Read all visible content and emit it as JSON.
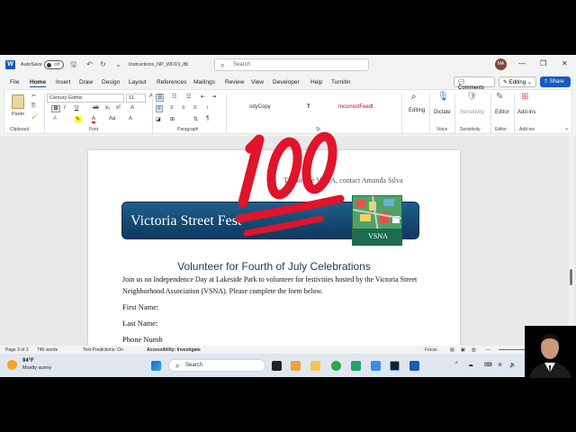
{
  "titlebar": {
    "autosave_label": "AutoSave",
    "autosave_state": "Off",
    "doc_title": "Instructions_NP_WD19_8b",
    "search_placeholder": "Search",
    "avatar_initials": "MA"
  },
  "menu": {
    "tabs": [
      "File",
      "Home",
      "Insert",
      "Draw",
      "Design",
      "Layout",
      "References",
      "Mailings",
      "Review",
      "View",
      "Developer",
      "Help",
      "Turnitin"
    ],
    "active_tab": "Home",
    "comments_label": "Comments",
    "editing_label": "Editing",
    "share_label": "Share"
  },
  "ribbon": {
    "paste_label": "Paste",
    "font_name": "Century Gothic",
    "font_size": "11",
    "styles": [
      "odyCopy",
      "T",
      "IncorrectFeedt"
    ],
    "editing_label": "Editing",
    "dictate_label": "Dictate",
    "sensitivity_label": "Sensitivity",
    "editor_label": "Editor",
    "addins_label": "Add-ins",
    "groups": {
      "clipboard": "Clipboard",
      "font": "Font",
      "paragraph": "Paragraph",
      "styles": "St",
      "voice": "Voice",
      "sensitivity": "Sensitivity",
      "editor": "Editor",
      "addins": "Add-ins"
    }
  },
  "document": {
    "header_text": "To join the VSNA, contact Amanda Silva",
    "banner_title": "Victoria Street Fest",
    "logo_text": "VSNA",
    "heading": "Volunteer for Fourth of July Celebrations",
    "intro": "Join us on Independence Day at Lakeside Park to volunteer for festivities hosted by the Victoria Street Neighborhood Association (VSNA). Please complete the form below.",
    "first_name_label": "First Name:",
    "last_name_label": "Last Name:",
    "phone_label": "Phone Numb"
  },
  "overlay": {
    "emoji": "hundred-points"
  },
  "statusbar": {
    "page": "Page 3 of 3",
    "words": "745 words",
    "text_predictions": "Text Predictions: On",
    "accessibility": "Accessibility: Investigate",
    "focus": "Focus"
  },
  "taskbar": {
    "temperature": "94°F",
    "weather": "Mostly sunny",
    "search_placeholder": "Search"
  },
  "colors": {
    "word_blue": "#185abd",
    "banner_blue": "#14456f",
    "heading_blue": "#1a3c60",
    "emoji_red": "#e0142b"
  }
}
